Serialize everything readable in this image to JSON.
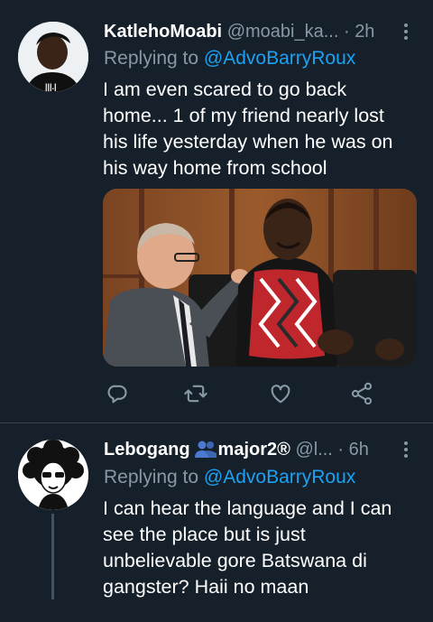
{
  "tweets": [
    {
      "display_name": "KatlehoMoabi",
      "handle": "@moabi_ka...",
      "separator": "·",
      "time": "2h",
      "replying_prefix": "Replying to",
      "replying_to": "@AdvoBarryRoux",
      "text": "I am even scared to go back home... 1 of my friend nearly lost his life yesterday when he was on his way home from school",
      "has_photo": true,
      "actions": [
        "reply-icon",
        "retweet-icon",
        "like-icon",
        "share-icon"
      ]
    },
    {
      "display_name": "Lebogang",
      "name_icon": "people-icon",
      "name_suffix": "major2®",
      "handle": "@l...",
      "separator": "·",
      "time": "6h",
      "replying_prefix": "Replying to",
      "replying_to": "@AdvoBarryRoux",
      "text": "I can hear the language and I can see the place but is just unbelievable gore Batswana di gangster? Haii no maan"
    }
  ],
  "colors": {
    "background": "#15202b",
    "secondary_text": "#8899a6",
    "link": "#1da1f2",
    "divider": "#38444d"
  }
}
